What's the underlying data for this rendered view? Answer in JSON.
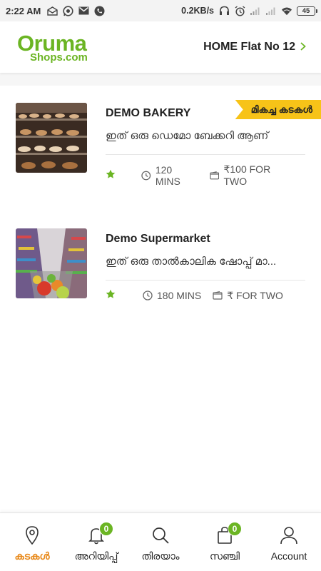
{
  "status_bar": {
    "time": "2:22 AM",
    "speed": "0.2KB/s",
    "battery": "45",
    "left_icons": [
      "mail-outline-icon",
      "whatsapp-icon",
      "gmail-icon",
      "phone-icon"
    ],
    "right_icons": [
      "headphones-icon",
      "alarm-icon",
      "signal-icon",
      "signal-icon",
      "wifi-icon",
      "battery-icon"
    ]
  },
  "header": {
    "logo_top": "Oruma",
    "logo_bottom": "Shops.com",
    "location": "HOME Flat No 12",
    "chevron_icon": "chevron-right-icon"
  },
  "shops": [
    {
      "name": "DEMO BAKERY",
      "badge": "മികച്ച കടകൾ",
      "description": "ഇത് ഒരു ഡെമോ ബേക്കറി ആണ്",
      "rating_icon": "star-icon",
      "time": "120 MINS",
      "price": "₹100 FOR TWO"
    },
    {
      "name": "Demo Supermarket",
      "badge": "",
      "description": "ഇത് ഒരു താൽകാലിക ഷോപ്പ് മാ...",
      "rating_icon": "star-icon",
      "time": "180 MINS",
      "price": "₹ FOR TWO"
    }
  ],
  "bottom_nav": [
    {
      "label": "കടകൾ",
      "icon": "location-pin-icon",
      "active": true
    },
    {
      "label": "അറിയിപ്പ്",
      "icon": "bell-icon",
      "badge": "0"
    },
    {
      "label": "തിരയാം",
      "icon": "search-icon"
    },
    {
      "label": "സഞ്ചി",
      "icon": "shopping-bag-icon",
      "badge": "0"
    },
    {
      "label": "Account",
      "icon": "user-icon"
    }
  ],
  "colors": {
    "brand_green": "#6bb523",
    "badge_yellow": "#f7c318",
    "active_orange": "#e8891a"
  }
}
